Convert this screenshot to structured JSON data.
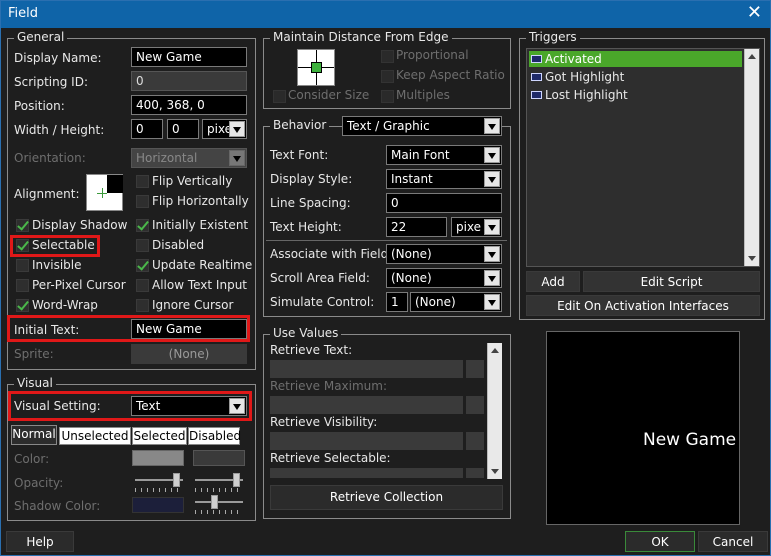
{
  "window": {
    "title": "Field",
    "close_glyph": "✕"
  },
  "general": {
    "legend": "General",
    "display_name_label": "Display Name:",
    "display_name_value": "New Game",
    "scripting_id_label": "Scripting ID:",
    "scripting_id_value": "0",
    "position_label": "Position:",
    "position_value": "400, 368, 0",
    "width_height_label": "Width / Height:",
    "width_value": "0",
    "height_value": "0",
    "size_unit": "pixe",
    "orientation_label": "Orientation:",
    "orientation_value": "Horizontal",
    "alignment_label": "Alignment:",
    "flip_vertically": "Flip Vertically",
    "flip_horizontally": "Flip Horizontally",
    "checkboxes": [
      {
        "label": "Display Shadow",
        "checked": true
      },
      {
        "label": "Initially Existent",
        "checked": true
      },
      {
        "label": "Selectable",
        "checked": true
      },
      {
        "label": "Disabled",
        "checked": false
      },
      {
        "label": "Invisible",
        "checked": false
      },
      {
        "label": "Update Realtime",
        "checked": true
      },
      {
        "label": "Per-Pixel Cursor",
        "checked": false
      },
      {
        "label": "Allow Text Input",
        "checked": false
      },
      {
        "label": "Word-Wrap",
        "checked": true
      },
      {
        "label": "Ignore Cursor",
        "checked": false
      }
    ],
    "initial_text_label": "Initial Text:",
    "initial_text_value": "New Game",
    "sprite_label": "Sprite:",
    "sprite_value": "(None)"
  },
  "visual": {
    "legend": "Visual",
    "setting_label": "Visual Setting:",
    "setting_value": "Text",
    "tabs": [
      "Normal",
      "Unselected",
      "Selected",
      "Disabled"
    ],
    "active_tab": "Normal",
    "color_label": "Color:",
    "opacity_label": "Opacity:",
    "shadow_color_label": "Shadow Color:"
  },
  "distance": {
    "legend": "Maintain Distance From Edge",
    "proportional": "Proportional",
    "keep_aspect": "Keep Aspect Ratio",
    "multiples": "Multiples",
    "consider_size": "Consider Size"
  },
  "behavior": {
    "legend": "Behavior",
    "type_value": "Text / Graphic",
    "text_font_label": "Text Font:",
    "text_font_value": "Main Font",
    "display_style_label": "Display Style:",
    "display_style_value": "Instant",
    "line_spacing_label": "Line Spacing:",
    "line_spacing_value": "0",
    "text_height_label": "Text Height:",
    "text_height_value": "22",
    "text_height_unit": "pixe",
    "assoc_label": "Associate with Field:",
    "assoc_value": "(None)",
    "scroll_label": "Scroll Area Field:",
    "scroll_value": "(None)",
    "simulate_label": "Simulate Control:",
    "simulate_num": "1",
    "simulate_value": "(None)"
  },
  "use_values": {
    "legend": "Use Values",
    "retrieve_text": "Retrieve Text:",
    "retrieve_maximum": "Retrieve Maximum:",
    "retrieve_visibility": "Retrieve Visibility:",
    "retrieve_selectable": "Retrieve Selectable:",
    "retrieve_collection": "Retrieve Collection"
  },
  "triggers": {
    "legend": "Triggers",
    "items": [
      "Activated",
      "Got Highlight",
      "Lost Highlight"
    ],
    "selected": "Activated",
    "add": "Add",
    "edit_script": "Edit Script",
    "edit_activation": "Edit On Activation Interfaces"
  },
  "preview": {
    "text": "New Game"
  },
  "footer": {
    "help": "Help",
    "ok": "OK",
    "cancel": "Cancel"
  }
}
